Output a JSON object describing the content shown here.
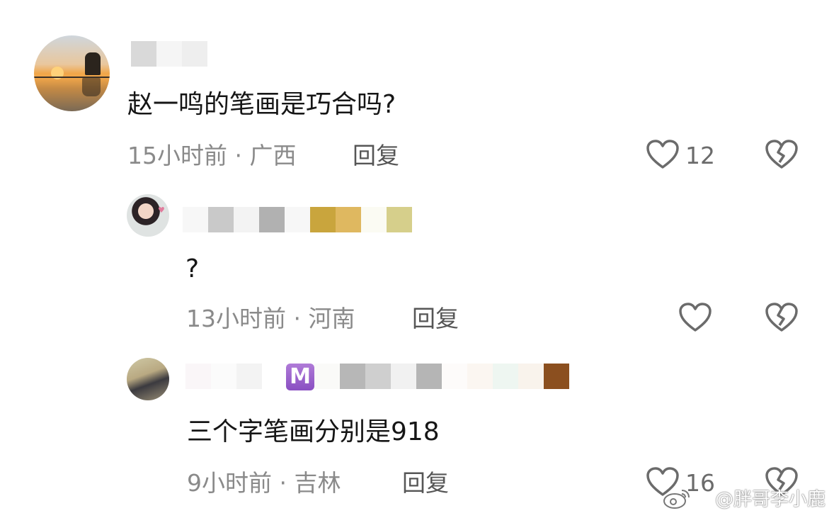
{
  "comments": [
    {
      "text": "赵一鸣的笔画是巧合吗?",
      "time": "15小时前",
      "region": "广西",
      "reply_label": "回复",
      "likes": "12"
    },
    {
      "text": "?",
      "time": "13小时前",
      "region": "河南",
      "reply_label": "回复"
    },
    {
      "text": "三个字笔画分别是918",
      "time": "9小时前",
      "region": "吉林",
      "reply_label": "回复",
      "likes": "16",
      "badge": "M"
    }
  ],
  "separator": "·",
  "watermark": {
    "text": "@胖哥李小鹿"
  },
  "icons": [
    "heart-outline-icon",
    "broken-heart-icon",
    "weibo-logo-icon"
  ],
  "colors": {
    "text": "#161616",
    "meta": "#8a8a8a",
    "icon": "#6b6b6b",
    "badge": "#8a4fc2"
  }
}
